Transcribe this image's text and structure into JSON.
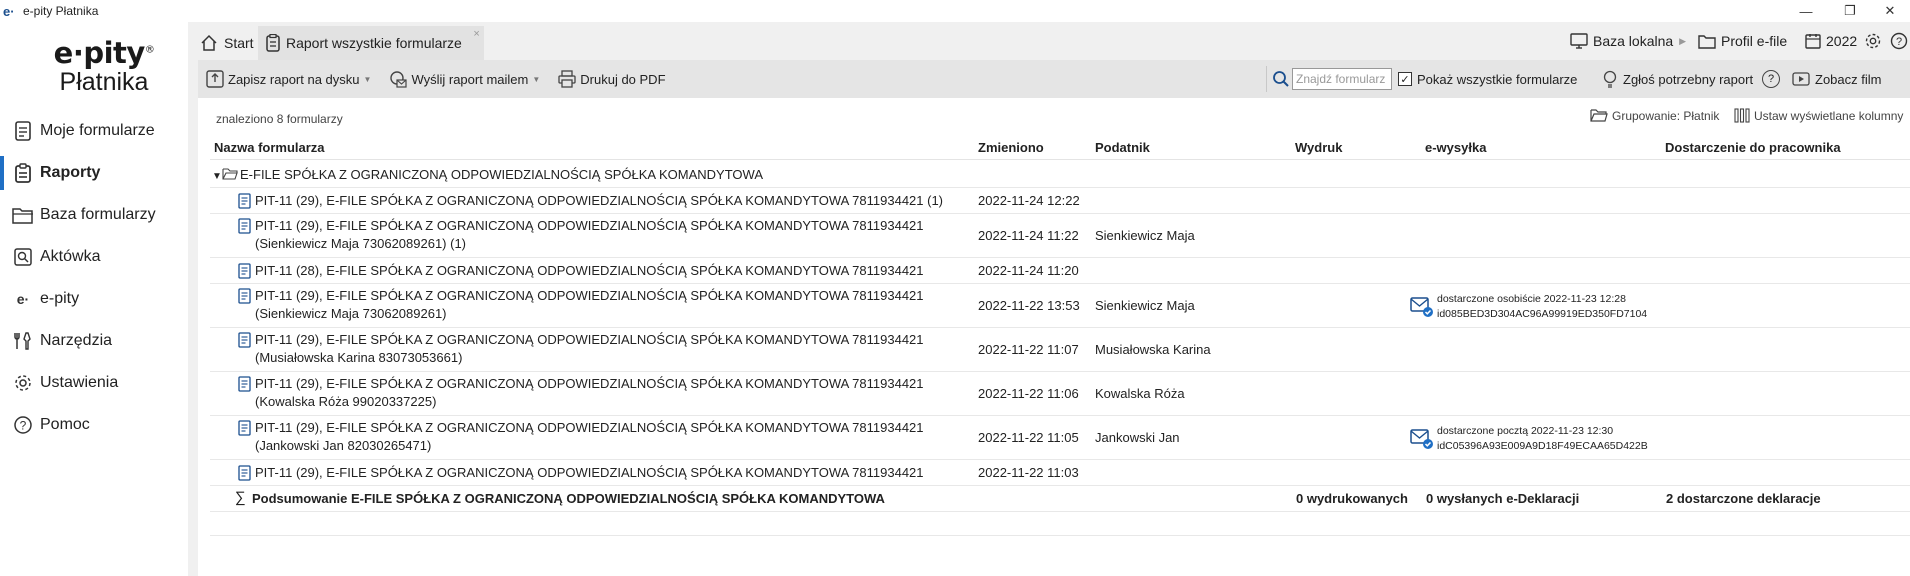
{
  "window": {
    "app_icon": "e·",
    "title": "e-pity Płatnika",
    "controls": [
      "minimize-icon",
      "restore-icon",
      "close-icon"
    ]
  },
  "logo": {
    "line1": "e·pity",
    "reg": "®",
    "line2": "Płatnika"
  },
  "sidebar": {
    "items": [
      {
        "label": "Moje formularze",
        "icon": "document-icon"
      },
      {
        "label": "Raporty",
        "icon": "report-icon",
        "active": true
      },
      {
        "label": "Baza formularzy",
        "icon": "folder-icon"
      },
      {
        "label": "Aktówka",
        "icon": "briefcase-icon"
      },
      {
        "label": "e-pity",
        "icon": "epity-icon"
      },
      {
        "label": "Narzędzia",
        "icon": "tools-icon"
      },
      {
        "label": "Ustawienia",
        "icon": "gear-icon"
      },
      {
        "label": "Pomoc",
        "icon": "help-icon"
      }
    ]
  },
  "tabs": [
    {
      "label": "Start",
      "icon": "home-icon"
    },
    {
      "label": "Raport wszystkie formularze",
      "icon": "report-icon",
      "close": "×"
    }
  ],
  "topbar": {
    "base": "Baza lokalna",
    "profile": "Profil e-file",
    "year": "2022"
  },
  "toolbar": {
    "save": "Zapisz raport na dysku",
    "send": "Wyślij raport mailem",
    "print": "Drukuj do PDF",
    "search_placeholder": "Znajdź formularz",
    "show_all": "Pokaż wszystkie formularze",
    "show_all_checked": "✓",
    "report_need": "Zgłoś potrzebny raport",
    "help": "?",
    "video": "Zobacz film"
  },
  "content": {
    "found": "znaleziono 8 formularzy",
    "grouping": "Grupowanie: Płatnik",
    "columns_setup": "Ustaw wyświetlane kolumny"
  },
  "table": {
    "headers": [
      "Nazwa formularza",
      "Zmieniono",
      "Podatnik",
      "Wydruk",
      "e-wysyłka",
      "Dostarczenie do pracownika"
    ],
    "group": "E-FILE SPÓŁKA Z OGRANICZONĄ ODPOWIEDZIALNOŚCIĄ SPÓŁKA KOMANDYTOWA",
    "rows": [
      {
        "name1": "PIT-11 (29), E-FILE SPÓŁKA Z OGRANICZONĄ ODPOWIEDZIALNOŚCIĄ SPÓŁKA KOMANDYTOWA 7811934421 (1)",
        "name2": "",
        "changed": "2022-11-24 12:22",
        "taxpayer": "",
        "del1": "",
        "del2": ""
      },
      {
        "name1": "PIT-11 (29), E-FILE SPÓŁKA Z OGRANICZONĄ ODPOWIEDZIALNOŚCIĄ SPÓŁKA KOMANDYTOWA 7811934421",
        "name2": "(Sienkiewicz Maja 73062089261) (1)",
        "changed": "2022-11-24 11:22",
        "taxpayer": "Sienkiewicz Maja",
        "del1": "",
        "del2": ""
      },
      {
        "name1": "PIT-11 (28), E-FILE SPÓŁKA Z OGRANICZONĄ ODPOWIEDZIALNOŚCIĄ SPÓŁKA KOMANDYTOWA 7811934421",
        "name2": "",
        "changed": "2022-11-24 11:20",
        "taxpayer": "",
        "del1": "",
        "del2": ""
      },
      {
        "name1": "PIT-11 (29), E-FILE SPÓŁKA Z OGRANICZONĄ ODPOWIEDZIALNOŚCIĄ SPÓŁKA KOMANDYTOWA 7811934421",
        "name2": "(Sienkiewicz Maja 73062089261)",
        "changed": "2022-11-22 13:53",
        "taxpayer": "Sienkiewicz Maja",
        "del1": "dostarczone osobiście 2022-11-23 12:28",
        "del2": "id085BED3D304AC96A99919ED350FD7104"
      },
      {
        "name1": "PIT-11 (29), E-FILE SPÓŁKA Z OGRANICZONĄ ODPOWIEDZIALNOŚCIĄ SPÓŁKA KOMANDYTOWA 7811934421",
        "name2": "(Musiałowska Karina 83073053661)",
        "changed": "2022-11-22 11:07",
        "taxpayer": "Musiałowska Karina",
        "del1": "",
        "del2": ""
      },
      {
        "name1": "PIT-11 (29), E-FILE SPÓŁKA Z OGRANICZONĄ ODPOWIEDZIALNOŚCIĄ SPÓŁKA KOMANDYTOWA 7811934421",
        "name2": "(Kowalska Róża 99020337225)",
        "changed": "2022-11-22 11:06",
        "taxpayer": "Kowalska Róża",
        "del1": "",
        "del2": ""
      },
      {
        "name1": "PIT-11 (29), E-FILE SPÓŁKA Z OGRANICZONĄ ODPOWIEDZIALNOŚCIĄ SPÓŁKA KOMANDYTOWA 7811934421",
        "name2": "(Jankowski Jan 82030265471)",
        "changed": "2022-11-22 11:05",
        "taxpayer": "Jankowski Jan",
        "del1": "dostarczone pocztą 2022-11-23 12:30",
        "del2": "idC05396A93E009A9D18F49ECAA65D422B"
      },
      {
        "name1": "PIT-11 (29), E-FILE SPÓŁKA Z OGRANICZONĄ ODPOWIEDZIALNOŚCIĄ SPÓŁKA KOMANDYTOWA 7811934421",
        "name2": "",
        "changed": "2022-11-22 11:03",
        "taxpayer": "",
        "del1": "",
        "del2": ""
      }
    ],
    "summary": {
      "name": "Podsumowanie E-FILE SPÓŁKA Z OGRANICZONĄ ODPOWIEDZIALNOŚCIĄ SPÓŁKA KOMANDYTOWA",
      "printed": "0 wydrukowanych",
      "sent": "0 wysłanych e-Deklaracji",
      "delivered": "2 dostarczone deklaracje"
    }
  },
  "colors": {
    "accent": "#1f6fc5",
    "toolbar_bg": "#e5e5e5",
    "gutter_bg": "#f0f0f0",
    "icon_blue": "#1b4f8e"
  }
}
